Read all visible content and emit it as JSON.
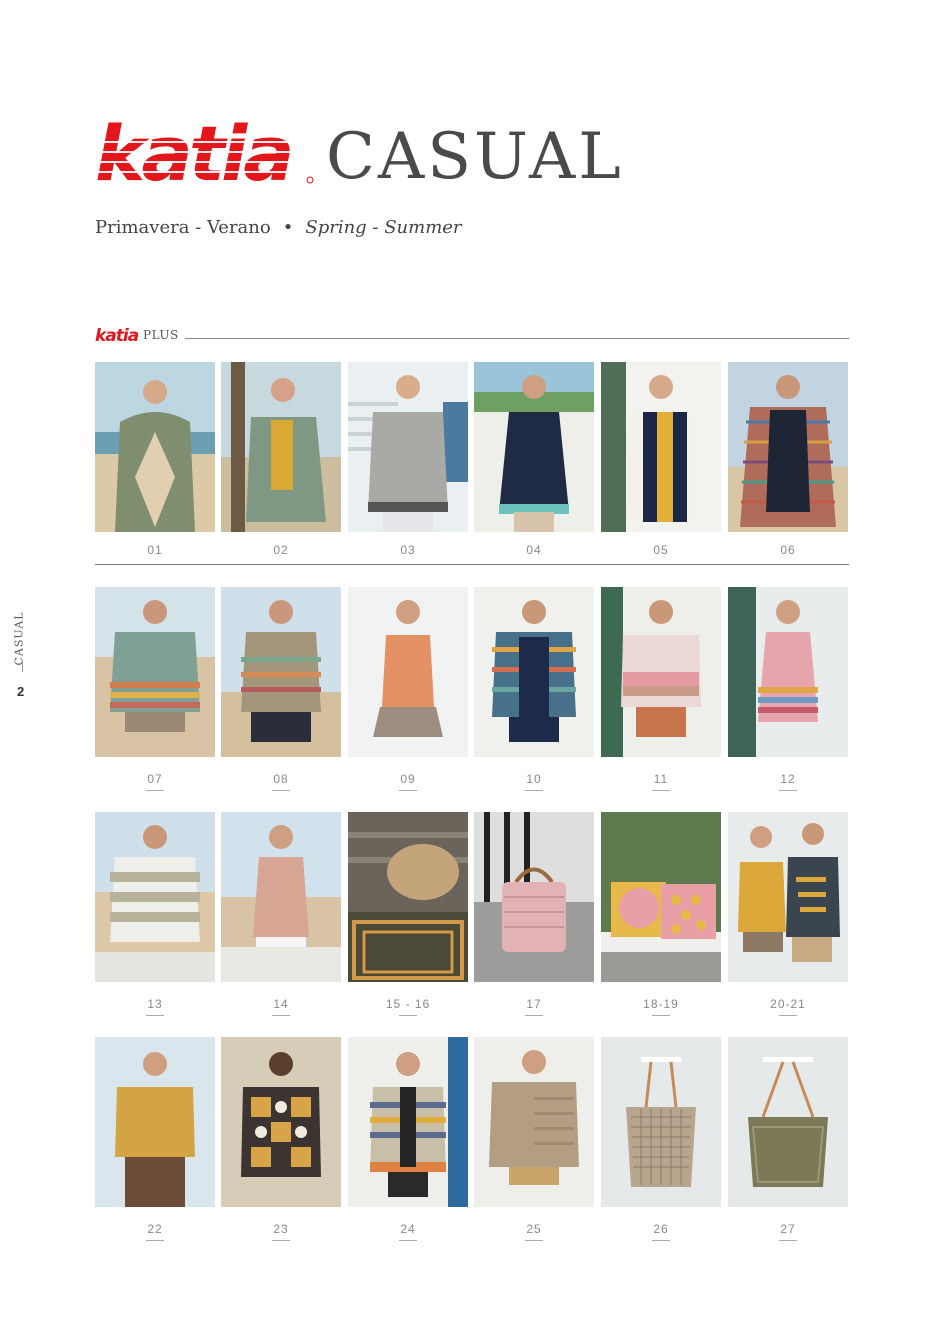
{
  "header": {
    "brand": "katia",
    "title": "CASUAL",
    "subtitle_es": "Primavera - Verano",
    "separator": "•",
    "subtitle_en": "Spring - Summer"
  },
  "section": {
    "brand": "katia",
    "label": "PLUS"
  },
  "sidebar": {
    "label": "CASUAL",
    "page_number": "2"
  },
  "colors": {
    "brand_red": "#e3161b"
  },
  "items": [
    {
      "label": "01"
    },
    {
      "label": "02"
    },
    {
      "label": "03"
    },
    {
      "label": "04"
    },
    {
      "label": "05"
    },
    {
      "label": "06"
    },
    {
      "label": "07"
    },
    {
      "label": "08"
    },
    {
      "label": "09"
    },
    {
      "label": "10"
    },
    {
      "label": "11"
    },
    {
      "label": "12"
    },
    {
      "label": "13"
    },
    {
      "label": "14"
    },
    {
      "label": "15 - 16"
    },
    {
      "label": "17"
    },
    {
      "label": "18-19"
    },
    {
      "label": "20-21"
    },
    {
      "label": "22"
    },
    {
      "label": "23"
    },
    {
      "label": "24"
    },
    {
      "label": "25"
    },
    {
      "label": "26"
    },
    {
      "label": "27"
    }
  ]
}
